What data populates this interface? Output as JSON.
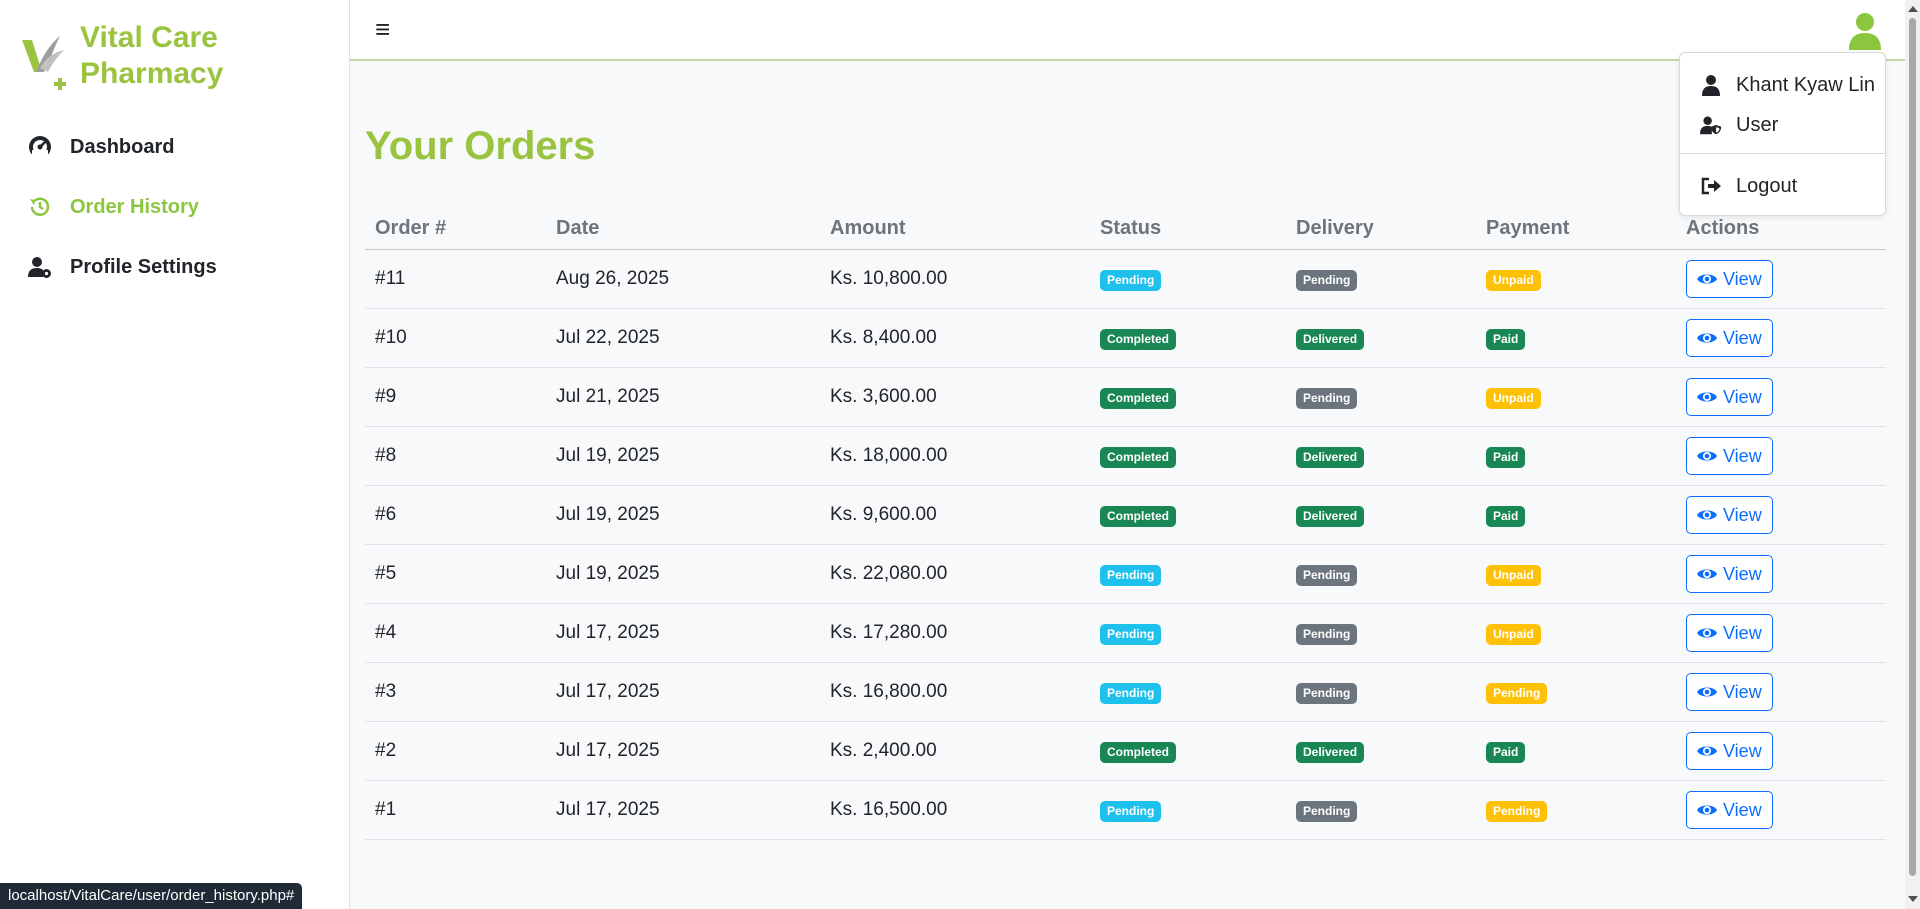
{
  "brand": {
    "line1": "Vital Care",
    "line2": "Pharmacy",
    "color": "#9ac33f"
  },
  "sidebar": {
    "items": [
      {
        "label": "Dashboard",
        "icon": "gauge-icon"
      },
      {
        "label": "Order History",
        "icon": "history-icon",
        "active": true
      },
      {
        "label": "Profile Settings",
        "icon": "user-gear-icon"
      }
    ]
  },
  "topbar": {
    "menu_glyph": "≡"
  },
  "user_menu": {
    "name": "Khant Kyaw Lin",
    "role": "User",
    "logout": "Logout"
  },
  "page": {
    "title": "Your Orders"
  },
  "table": {
    "headers": [
      "Order #",
      "Date",
      "Amount",
      "Status",
      "Delivery",
      "Payment",
      "Actions"
    ],
    "view_label": "View",
    "rows": [
      {
        "order": "#11",
        "date": "Aug 26, 2025",
        "amount": "Ks. 10,800.00",
        "status": "Pending",
        "delivery": "Pending",
        "payment": "Unpaid"
      },
      {
        "order": "#10",
        "date": "Jul 22, 2025",
        "amount": "Ks. 8,400.00",
        "status": "Completed",
        "delivery": "Delivered",
        "payment": "Paid"
      },
      {
        "order": "#9",
        "date": "Jul 21, 2025",
        "amount": "Ks. 3,600.00",
        "status": "Completed",
        "delivery": "Pending",
        "payment": "Unpaid"
      },
      {
        "order": "#8",
        "date": "Jul 19, 2025",
        "amount": "Ks. 18,000.00",
        "status": "Completed",
        "delivery": "Delivered",
        "payment": "Paid"
      },
      {
        "order": "#6",
        "date": "Jul 19, 2025",
        "amount": "Ks. 9,600.00",
        "status": "Completed",
        "delivery": "Delivered",
        "payment": "Paid"
      },
      {
        "order": "#5",
        "date": "Jul 19, 2025",
        "amount": "Ks. 22,080.00",
        "status": "Pending",
        "delivery": "Pending",
        "payment": "Unpaid"
      },
      {
        "order": "#4",
        "date": "Jul 17, 2025",
        "amount": "Ks. 17,280.00",
        "status": "Pending",
        "delivery": "Pending",
        "payment": "Unpaid"
      },
      {
        "order": "#3",
        "date": "Jul 17, 2025",
        "amount": "Ks. 16,800.00",
        "status": "Pending",
        "delivery": "Pending",
        "payment": "Pending"
      },
      {
        "order": "#2",
        "date": "Jul 17, 2025",
        "amount": "Ks. 2,400.00",
        "status": "Completed",
        "delivery": "Delivered",
        "payment": "Paid"
      },
      {
        "order": "#1",
        "date": "Jul 17, 2025",
        "amount": "Ks. 16,500.00",
        "status": "Pending",
        "delivery": "Pending",
        "payment": "Pending"
      }
    ]
  },
  "status_bar": {
    "url": "localhost/VitalCare/user/order_history.php#"
  },
  "colors": {
    "accent": "#8cc63f",
    "info": "#1ec1ec",
    "success": "#198754",
    "secondary": "#6c757d",
    "warning": "#ffc107",
    "primary": "#0d6efd"
  }
}
